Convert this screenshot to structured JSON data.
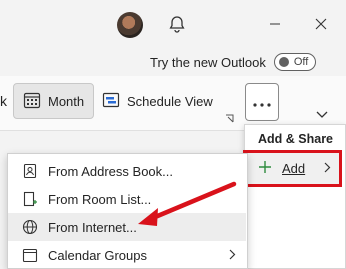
{
  "titlebar": {
    "minimize_icon": "minimize-icon",
    "close_icon": "close-icon",
    "bell_icon": "bell-icon"
  },
  "try_outlook": {
    "label": "Try the new Outlook",
    "toggle_text": "Off"
  },
  "ribbon": {
    "left_partial": "k",
    "month_label": "Month",
    "schedule_label": "Schedule View",
    "more_icon": "more-icon"
  },
  "share_panel": {
    "title": "Add & Share",
    "add_label": "Add",
    "accent_color": "#d9121b"
  },
  "submenu": {
    "items": [
      {
        "label": "From Address Book...",
        "icon": "address-book-icon"
      },
      {
        "label": "From Room List...",
        "icon": "room-list-icon"
      },
      {
        "label": "From Internet...",
        "icon": "globe-icon"
      },
      {
        "label": "Calendar Groups",
        "icon": "calendar-groups-icon"
      }
    ]
  },
  "background": {
    "partial_text": "t"
  }
}
